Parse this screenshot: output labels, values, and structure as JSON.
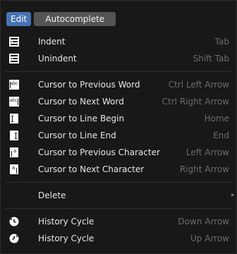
{
  "tabs": [
    {
      "label": "Edit",
      "active": true
    },
    {
      "label": "Autocomplete",
      "active": false
    }
  ],
  "group1": [
    {
      "label": "Indent",
      "shortcut": "Tab",
      "icon": "indent-icon"
    },
    {
      "label": "Unindent",
      "shortcut": "Shift Tab",
      "icon": "unindent-icon"
    }
  ],
  "group2": [
    {
      "label": "Cursor to Previous Word",
      "shortcut": "Ctrl Left Arrow",
      "icon": "previous-word-icon"
    },
    {
      "label": "Cursor to Next Word",
      "shortcut": "Ctrl Right Arrow",
      "icon": "next-word-icon"
    },
    {
      "label": "Cursor to Line Begin",
      "shortcut": "Home",
      "icon": "line-begin-icon"
    },
    {
      "label": "Cursor to Line End",
      "shortcut": "End",
      "icon": "line-end-icon"
    },
    {
      "label": "Cursor to Previous Character",
      "shortcut": "Left Arrow",
      "icon": "previous-character-icon"
    },
    {
      "label": "Cursor to Next Character",
      "shortcut": "Right Arrow",
      "icon": "next-character-icon"
    }
  ],
  "group3": [
    {
      "label": "Delete",
      "shortcut": "",
      "submenu": "▸"
    }
  ],
  "group4": [
    {
      "label": "History Cycle",
      "shortcut": "Down Arrow",
      "icon": "history-cycle-down-icon"
    },
    {
      "label": "History Cycle",
      "shortcut": "Up Arrow",
      "icon": "history-cycle-up-icon"
    }
  ]
}
